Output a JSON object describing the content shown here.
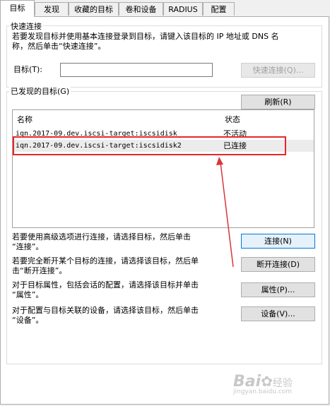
{
  "tabs": [
    {
      "label": "目标",
      "active": true
    },
    {
      "label": "发现"
    },
    {
      "label": "收藏的目标"
    },
    {
      "label": "卷和设备"
    },
    {
      "label": "RADIUS"
    },
    {
      "label": "配置"
    }
  ],
  "quick_connect": {
    "legend": "快速连接",
    "description_line1": "若要发现目标并使用基本连接登录到目标，请键入该目标的 IP 地址或 DNS 名",
    "description_line2": "称，然后单击“快速连接”。",
    "target_label": "目标(T):",
    "target_value": "",
    "button_label": "快速连接(Q)..."
  },
  "discovered": {
    "legend": "已发现的目标(G)",
    "refresh_label": "刷新(R)",
    "columns": [
      "名称",
      "状态"
    ],
    "rows": [
      {
        "name": "iqn.2017-09.dev.iscsi-target:iscsidisk",
        "status": "不活动"
      },
      {
        "name": "iqn.2017-09.dev.iscsi-target:iscsidisk2",
        "status": "已连接"
      }
    ]
  },
  "actions": [
    {
      "text_line1": "若要使用高级选项进行连接，请选择目标，然后单击",
      "text_line2": "“连接”。",
      "button": "连接(N)"
    },
    {
      "text_line1": "若要完全断开某个目标的连接，请选择该目标，然后单",
      "text_line2": "击“断开连接”。",
      "button": "断开连接(D)"
    },
    {
      "text_line1": "对于目标属性，包括会话的配置，请选择该目标并单击",
      "text_line2": "“属性”。",
      "button": "属性(P)..."
    },
    {
      "text_line1": "对于配置与目标关联的设备，请选择该目标，然后单击",
      "text_line2": "“设备”。",
      "button": "设备(V)..."
    }
  ],
  "watermark": {
    "brand": "Bai",
    "brand2": "经验",
    "sub": "jingyan.baidu.com"
  },
  "colors": {
    "highlight_box": "#e8262a",
    "arrow": "#d9363a",
    "focus": "#0078d7"
  }
}
